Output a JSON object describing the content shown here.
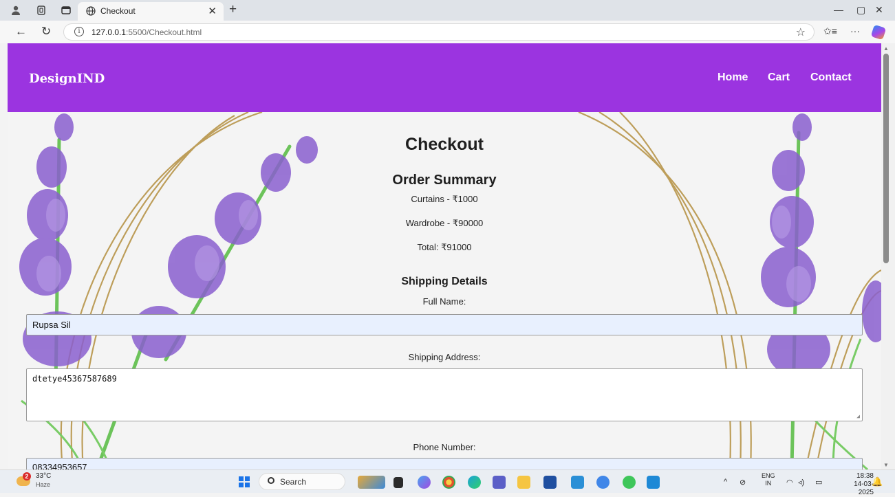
{
  "browser": {
    "tab_title": "Checkout",
    "url_host": "127.0.0.1",
    "url_rest": ":5500/Checkout.html"
  },
  "header": {
    "brand": "DesignIND",
    "nav": [
      "Home",
      "Cart",
      "Contact"
    ]
  },
  "checkout": {
    "title": "Checkout",
    "summary_heading": "Order Summary",
    "items": [
      "Curtains - ₹1000",
      "Wardrobe - ₹90000"
    ],
    "total": "Total: ₹91000",
    "shipping_heading": "Shipping Details",
    "full_name_label": "Full Name:",
    "full_name_value": "Rupsa Sil",
    "address_label": "Shipping Address:",
    "address_value": "dtetye45367587689",
    "phone_label": "Phone Number:",
    "phone_value": "08334953657"
  },
  "taskbar": {
    "weather_badge": "2",
    "temperature": "33°C",
    "condition": "Haze",
    "search_placeholder": "Search",
    "lang_top": "ENG",
    "lang_bottom": "IN",
    "time": "18:38",
    "date": "14-03-2025"
  },
  "colors": {
    "header_bg": "#9b34e0",
    "page_bg": "#f4f4f4",
    "input_autofill_bg": "#e8f0fe"
  }
}
